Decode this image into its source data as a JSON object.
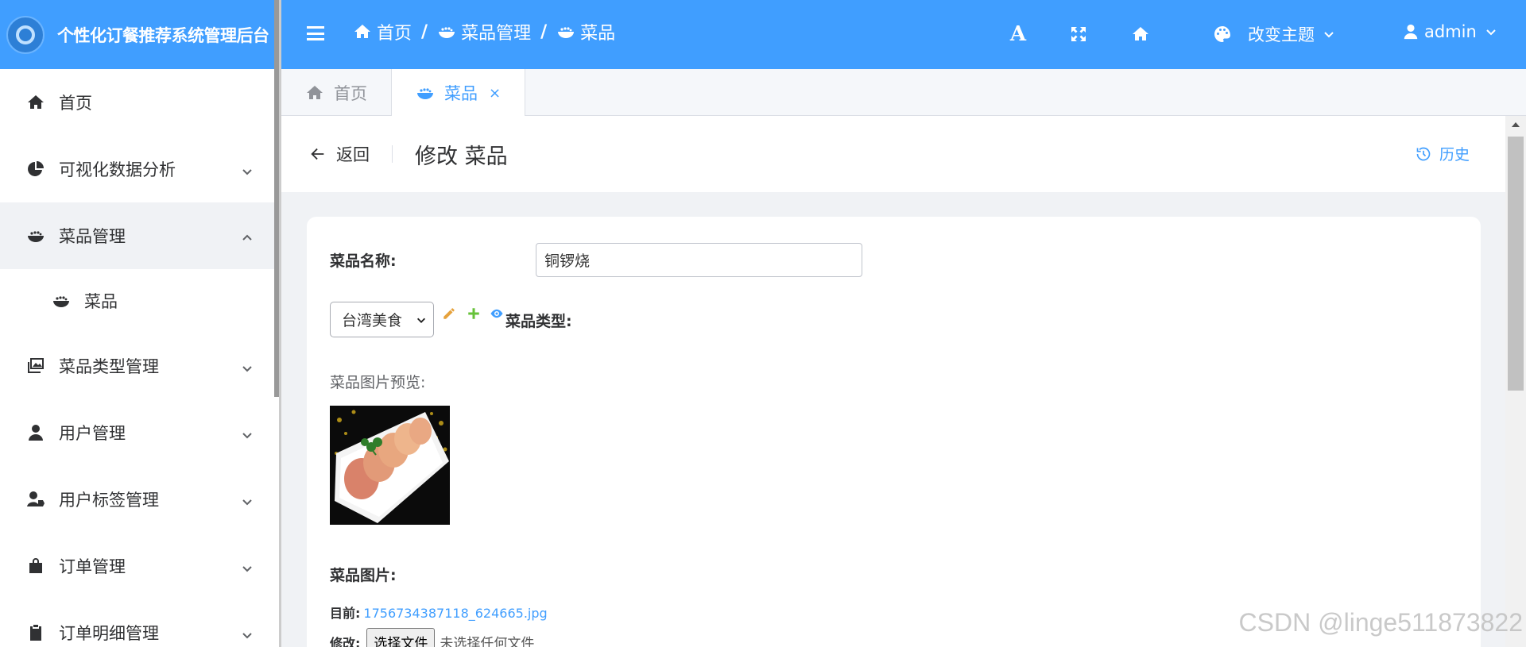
{
  "brand": {
    "title": "个性化订餐推荐系统管理后台"
  },
  "sidebar": {
    "items": [
      {
        "label": "首页",
        "icon": "home-icon"
      },
      {
        "label": "可视化数据分析",
        "icon": "chart-pie-icon"
      },
      {
        "label": "菜品管理",
        "icon": "bowl-icon"
      },
      {
        "label": "菜品",
        "icon": "bowl-icon"
      },
      {
        "label": "菜品类型管理",
        "icon": "images-icon"
      },
      {
        "label": "用户管理",
        "icon": "user-icon"
      },
      {
        "label": "用户标签管理",
        "icon": "user-tag-icon"
      },
      {
        "label": "订单管理",
        "icon": "bag-icon"
      },
      {
        "label": "订单明细管理",
        "icon": "clipboard-icon"
      }
    ]
  },
  "header": {
    "breadcrumb": [
      "首页",
      "菜品管理",
      "菜品"
    ],
    "font_icon_label": "A",
    "theme_label": "改变主题",
    "user_label": "admin"
  },
  "tabs": [
    {
      "label": "首页",
      "active": false
    },
    {
      "label": "菜品",
      "active": true,
      "close": "×"
    }
  ],
  "page": {
    "back_label": "返回",
    "title": "修改 菜品",
    "history_label": "历史"
  },
  "form": {
    "name_label": "菜品名称:",
    "name_value": "铜锣烧",
    "type_select_value": "台湾美食",
    "type_label": "菜品类型:",
    "preview_label": "菜品图片预览:",
    "image_label": "菜品图片:",
    "current_label": "目前:",
    "current_file": "1756734387118_624665.jpg",
    "modify_label": "修改:",
    "file_button": "选择文件",
    "file_none": "未选择任何文件"
  },
  "watermark": "CSDN @linge511873822",
  "colors": {
    "primary": "#409eff",
    "text": "#303133",
    "pencil": "#e6a23c",
    "plus": "#67c23a"
  }
}
